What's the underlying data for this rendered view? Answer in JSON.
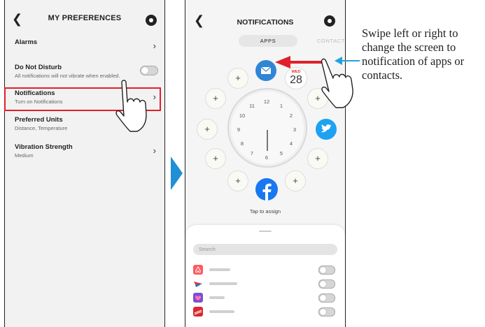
{
  "screen1": {
    "title": "MY PREFERENCES",
    "items": [
      {
        "title": "Alarms",
        "subtitle": ""
      },
      {
        "title": "Do Not Disturb",
        "subtitle": "All notifications will not vibrate when enabled."
      },
      {
        "title": "Notifications",
        "subtitle": "Turn on Notifications"
      },
      {
        "title": "Preferred Units",
        "subtitle": "Distance, Temperature"
      },
      {
        "title": "Vibration Strength",
        "subtitle": "Medium"
      }
    ]
  },
  "screen2": {
    "title": "NOTIFICATIONS",
    "tabs": {
      "apps": "APPS",
      "contacts": "CONTACTS"
    },
    "slot_symbol": "+",
    "calendar": {
      "day": "WED",
      "date": "28"
    },
    "clock_numbers": [
      "12",
      "1",
      "2",
      "3",
      "4",
      "5",
      "6",
      "7",
      "8",
      "9",
      "10",
      "11"
    ],
    "tap_label": "Tap to assign",
    "search_placeholder": "Search",
    "app_rows": [
      {
        "icon": "airbnb-icon",
        "color": "#ff5a5f"
      },
      {
        "icon": "american-airlines-icon",
        "color": "#2a6ebb"
      },
      {
        "icon": "pocket-icon",
        "color": "#7b4fd6"
      },
      {
        "icon": "bank-icon",
        "color": "#d9282f"
      }
    ]
  },
  "caption": "Swipe left or right to change the screen to notification of apps or contacts.",
  "colors": {
    "highlight": "#e0202a",
    "arrow_blue": "#1f8fd6",
    "facebook": "#1877f2",
    "twitter": "#1da1f2",
    "mail": "#2f86d6"
  }
}
